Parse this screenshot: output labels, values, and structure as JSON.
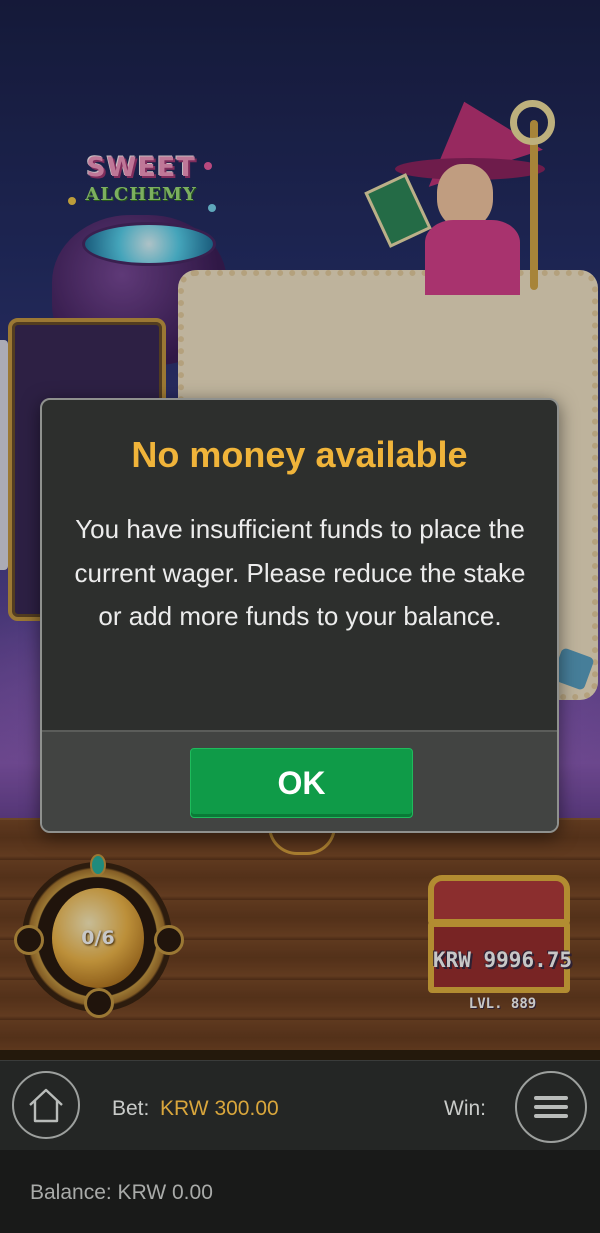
{
  "game": {
    "logo_line1": "SWEET",
    "logo_line2": "ALCHEMY",
    "progress_counter": "0/6",
    "chest_amount": "KRW 9996.75",
    "chest_level": "LVL. 889"
  },
  "dialog": {
    "title": "No money available",
    "message": "You have insufficient funds to place the current wager. Please reduce the stake or add more funds to your balance.",
    "ok_label": "OK"
  },
  "bottom_bar": {
    "bet_label": "Bet:",
    "bet_value": "KRW 300.00",
    "win_label": "Win:",
    "balance_text": "Balance: KRW 0.00"
  },
  "icons": {
    "home": "home-icon",
    "menu": "hamburger-menu-icon"
  },
  "colors": {
    "dialog_title": "#f0b43a",
    "ok_button": "#0f9b48",
    "bet_value": "#d9a63c"
  }
}
